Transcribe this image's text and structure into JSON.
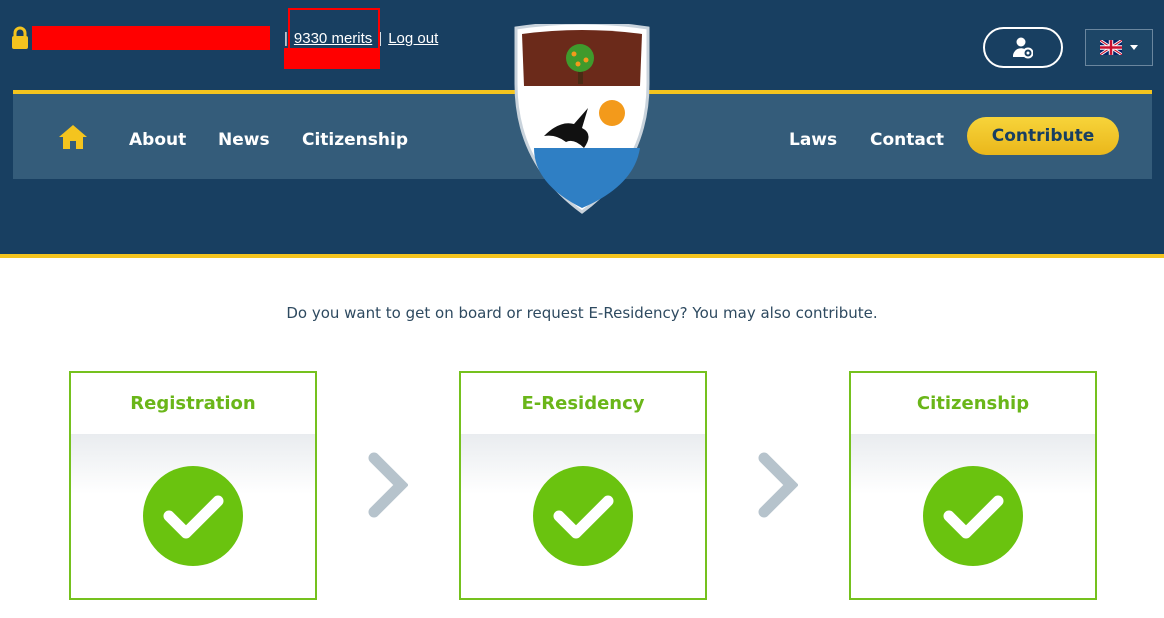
{
  "header": {
    "merits_label": "9330 merits",
    "separator": "|",
    "logout_label": "Log out",
    "language_flag": "uk-flag-icon"
  },
  "nav": {
    "left_items": [
      "About",
      "News",
      "Citizenship"
    ],
    "right_items": [
      "Laws",
      "Contact"
    ],
    "contribute_label": "Contribute"
  },
  "main": {
    "intro": "Do you want to get on board or request E-Residency? You may also contribute.",
    "steps": [
      {
        "title": "Registration",
        "status": "check-icon"
      },
      {
        "title": "E-Residency",
        "status": "check-icon"
      },
      {
        "title": "Citizenship",
        "status": "check-icon"
      }
    ]
  },
  "colors": {
    "header_bg": "#183f61",
    "nav_bg": "#345c7a",
    "accent_yellow": "#f4c41e",
    "green": "#6ab619",
    "redaction": "#ff0000"
  }
}
